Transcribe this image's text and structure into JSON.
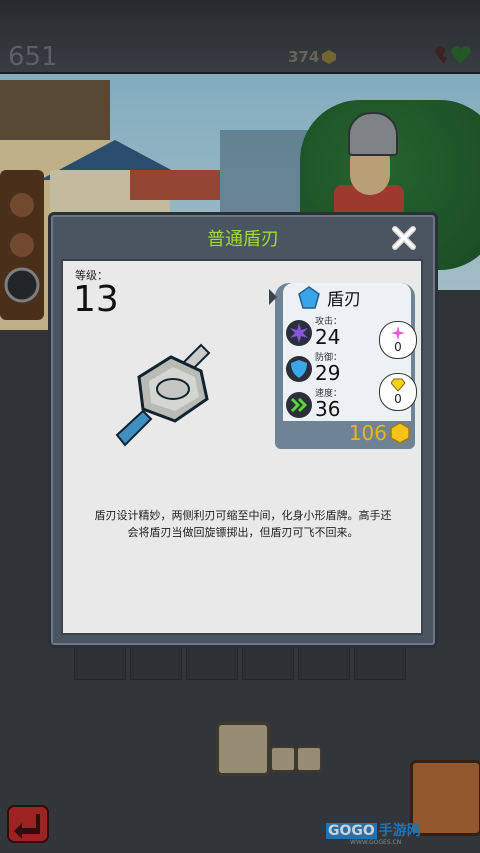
{
  "hud": {
    "score": "651",
    "coins": "374"
  },
  "item": {
    "title": "普通盾刃",
    "level_label": "等级：",
    "level_value": "13",
    "name": "盾刃",
    "stats": [
      {
        "label": "攻击：",
        "value": "24"
      },
      {
        "label": "防御：",
        "value": "29"
      },
      {
        "label": "速度：",
        "value": "36"
      }
    ],
    "bonuses": [
      {
        "value": "0"
      },
      {
        "value": "0"
      }
    ],
    "price": "106",
    "description": "盾刃设计精妙，两侧利刃可缩至中间，化身小形盾牌。高手还会将盾刃当做回旋镖掷出，但盾刃可飞不回来。"
  },
  "watermark": {
    "brand_prefix": "GOGO",
    "brand_suffix": "手游网",
    "url": "WWW.GOGES.CN"
  },
  "colors": {
    "title": "#9fdc2e",
    "price": "#f0b020",
    "panel": "#e9e9e9",
    "frame": "#4a5561"
  },
  "icons": {
    "close": "close-icon",
    "crystal": "blue-crystal-icon",
    "attack": "purple-burst-icon",
    "defense": "blue-shield-icon",
    "speed": "green-chevron-icon",
    "bonus1": "pink-star-icon",
    "bonus2": "yellow-gem-icon",
    "coin": "gold-coin-icon"
  }
}
